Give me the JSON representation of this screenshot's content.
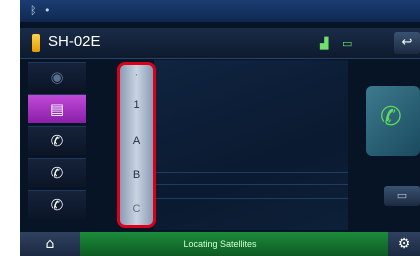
{
  "header": {
    "device_name": "SH-02E"
  },
  "index_scroll": {
    "letters": [
      "1",
      "A",
      "B",
      "C"
    ]
  },
  "footer": {
    "status": "Locating Satellites"
  },
  "icons": {
    "status_bar": [
      "bluetooth-icon",
      "dot-icon"
    ],
    "header": [
      "phone-battery-icon",
      "signal-icon",
      "battery-icon",
      "back-icon"
    ],
    "left_column": [
      "voice-icon",
      "phonebook-icon",
      "incoming-call-icon",
      "outgoing-call-icon",
      "missed-call-icon"
    ],
    "right_panel": [
      "call-icon"
    ],
    "footer": [
      "navigation-icon",
      "settings-icon"
    ]
  },
  "colors": {
    "accent_purple": "#b13ccf",
    "highlight_red": "#d8001a",
    "footer_green": "#17823a"
  }
}
